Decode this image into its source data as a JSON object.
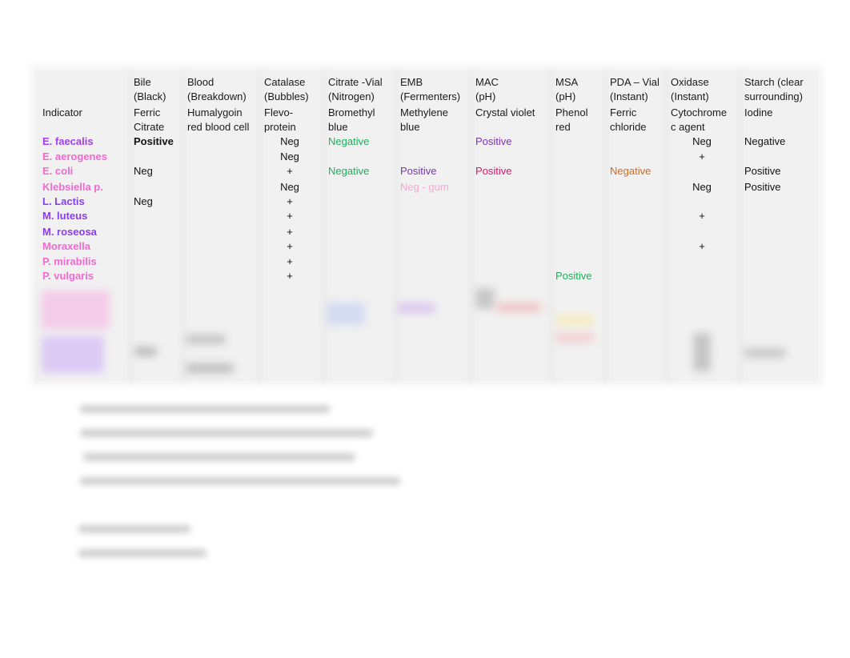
{
  "table": {
    "headers": [
      {
        "line1": "",
        "line2": "",
        "line3": "Indicator",
        "line4": ""
      },
      {
        "line1": "Bile",
        "line2": "(Black)",
        "line3": "Ferric",
        "line4": "Citrate"
      },
      {
        "line1": "Blood",
        "line2": "(Breakdown)",
        "line3": "Humalygoin",
        "line4": "red blood cell"
      },
      {
        "line1": "Catalase",
        "line2": "(Bubbles)",
        "line3": "Flevo-",
        "line4": "protein"
      },
      {
        "line1": "Citrate -Vial",
        "line2": "(Nitrogen)",
        "line3": "Bromethyl",
        "line4": "blue"
      },
      {
        "line1": "EMB",
        "line2": "(Fermenters)",
        "line3": "Methylene",
        "line4": "blue"
      },
      {
        "line1": "MAC",
        "line2": "(pH)",
        "line3": "Crystal violet",
        "line4": ""
      },
      {
        "line1": "MSA",
        "line2": "(pH)",
        "line3": "Phenol",
        "line4": "red"
      },
      {
        "line1": "PDA – Vial",
        "line2": "(Instant)",
        "line3": "Ferric",
        "line4": "chloride"
      },
      {
        "line1": "Oxidase",
        "line2": "(Instant)",
        "line3": "Cytochrome",
        "line4": "c agent"
      },
      {
        "line1": "Starch (clear",
        "line2": "surrounding)",
        "line3": "Iodine",
        "line4": ""
      }
    ],
    "rows": [
      {
        "organism": "E. faecalis",
        "color": "#a23df0",
        "cells": [
          {
            "text": "Positive",
            "color": "#111111",
            "bold": true
          },
          {
            "text": ""
          },
          {
            "text": "Neg"
          },
          {
            "text": "Negative",
            "color": "#1fae5a"
          },
          {
            "text": ""
          },
          {
            "text": "Positive",
            "color": "#7a35b0"
          },
          {
            "text": ""
          },
          {
            "text": ""
          },
          {
            "text": "Neg"
          },
          {
            "text": "Negative"
          }
        ]
      },
      {
        "organism": "E. aerogenes",
        "color": "#f06ad0",
        "cells": [
          {
            "text": ""
          },
          {
            "text": ""
          },
          {
            "text": "Neg"
          },
          {
            "text": ""
          },
          {
            "text": ""
          },
          {
            "text": ""
          },
          {
            "text": ""
          },
          {
            "text": ""
          },
          {
            "text": "+"
          },
          {
            "text": ""
          }
        ]
      },
      {
        "organism": "E. coli",
        "color": "#f06ad0",
        "cells": [
          {
            "text": "Neg"
          },
          {
            "text": ""
          },
          {
            "text": "+"
          },
          {
            "text": "Negative",
            "color": "#1fae5a"
          },
          {
            "text": "Positive",
            "color": "#7a35b0"
          },
          {
            "text": "Positive",
            "color": "#e8126e"
          },
          {
            "text": ""
          },
          {
            "text": "Negative",
            "color": "#d2691e"
          },
          {
            "text": ""
          },
          {
            "text": "Positive"
          }
        ]
      },
      {
        "organism": "Klebsiella p.",
        "color": "#f06ad0",
        "cells": [
          {
            "text": ""
          },
          {
            "text": ""
          },
          {
            "text": "Neg"
          },
          {
            "text": ""
          },
          {
            "text": "Neg - gum",
            "color": "#f7a6d4"
          },
          {
            "text": ""
          },
          {
            "text": ""
          },
          {
            "text": ""
          },
          {
            "text": "Neg"
          },
          {
            "text": "Positive"
          }
        ]
      },
      {
        "organism": "L. Lactis",
        "color": "#8a3cf0",
        "cells": [
          {
            "text": "Neg"
          },
          {
            "text": ""
          },
          {
            "text": "+"
          },
          {
            "text": ""
          },
          {
            "text": ""
          },
          {
            "text": ""
          },
          {
            "text": ""
          },
          {
            "text": ""
          },
          {
            "text": ""
          },
          {
            "text": ""
          }
        ]
      },
      {
        "organism": "M. luteus",
        "color": "#8a3cf0",
        "cells": [
          {
            "text": ""
          },
          {
            "text": ""
          },
          {
            "text": "+"
          },
          {
            "text": ""
          },
          {
            "text": ""
          },
          {
            "text": ""
          },
          {
            "text": ""
          },
          {
            "text": ""
          },
          {
            "text": "+"
          },
          {
            "text": ""
          }
        ]
      },
      {
        "organism": "M. roseosa",
        "color": "#8a3cf0",
        "cells": [
          {
            "text": ""
          },
          {
            "text": ""
          },
          {
            "text": "+"
          },
          {
            "text": ""
          },
          {
            "text": ""
          },
          {
            "text": ""
          },
          {
            "text": ""
          },
          {
            "text": ""
          },
          {
            "text": ""
          },
          {
            "text": ""
          }
        ]
      },
      {
        "organism": "Moraxella",
        "color": "#f06ad0",
        "cells": [
          {
            "text": ""
          },
          {
            "text": ""
          },
          {
            "text": "+"
          },
          {
            "text": ""
          },
          {
            "text": ""
          },
          {
            "text": ""
          },
          {
            "text": ""
          },
          {
            "text": ""
          },
          {
            "text": "+"
          },
          {
            "text": ""
          }
        ]
      },
      {
        "organism": "P. mirabilis",
        "color": "#f06ad0",
        "cells": [
          {
            "text": ""
          },
          {
            "text": ""
          },
          {
            "text": "+"
          },
          {
            "text": ""
          },
          {
            "text": ""
          },
          {
            "text": ""
          },
          {
            "text": ""
          },
          {
            "text": ""
          },
          {
            "text": ""
          },
          {
            "text": ""
          }
        ]
      },
      {
        "organism": "P. vulgaris",
        "color": "#f06ad0",
        "cells": [
          {
            "text": ""
          },
          {
            "text": ""
          },
          {
            "text": "+"
          },
          {
            "text": ""
          },
          {
            "text": ""
          },
          {
            "text": ""
          },
          {
            "text": "Positive",
            "color": "#1fae5a"
          },
          {
            "text": ""
          },
          {
            "text": ""
          },
          {
            "text": ""
          }
        ]
      }
    ]
  }
}
